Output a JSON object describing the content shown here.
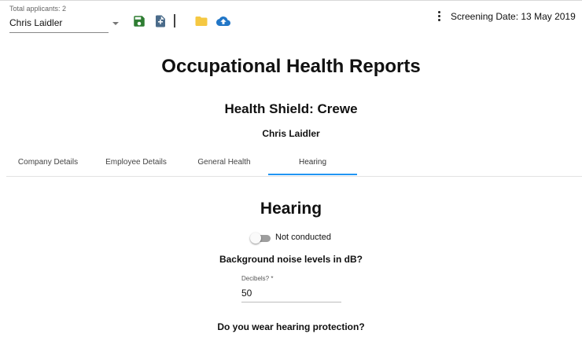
{
  "toolbar": {
    "applicant_count_label": "Total applicants: 2",
    "selected_applicant": "Chris Laidler",
    "screening_date": "Screening Date: 13 May 2019",
    "icons": [
      "save-icon",
      "add-document-icon",
      "folder-icon",
      "cloud-upload-icon",
      "more-vert-icon"
    ]
  },
  "header": {
    "title": "Occupational Health Reports",
    "company": "Health Shield: Crewe",
    "person": "Chris Laidler"
  },
  "tabs": [
    {
      "label": "Company Details",
      "active": false
    },
    {
      "label": "Employee Details",
      "active": false
    },
    {
      "label": "General Health",
      "active": false
    },
    {
      "label": "Hearing",
      "active": true
    }
  ],
  "hearing": {
    "title": "Hearing",
    "toggle_label": "Not conducted",
    "toggle_on": false,
    "question_noise": "Background noise levels in dB?",
    "decibels_label": "Decibels? *",
    "decibels_value": "50",
    "question_protection": "Do you wear hearing protection?"
  },
  "colors": {
    "accent": "#2196f3",
    "save_icon": "#2e7d32",
    "add_doc_icon": "#4a6b8a",
    "folder_icon": "#f5c842",
    "upload_icon": "#2176c7"
  }
}
